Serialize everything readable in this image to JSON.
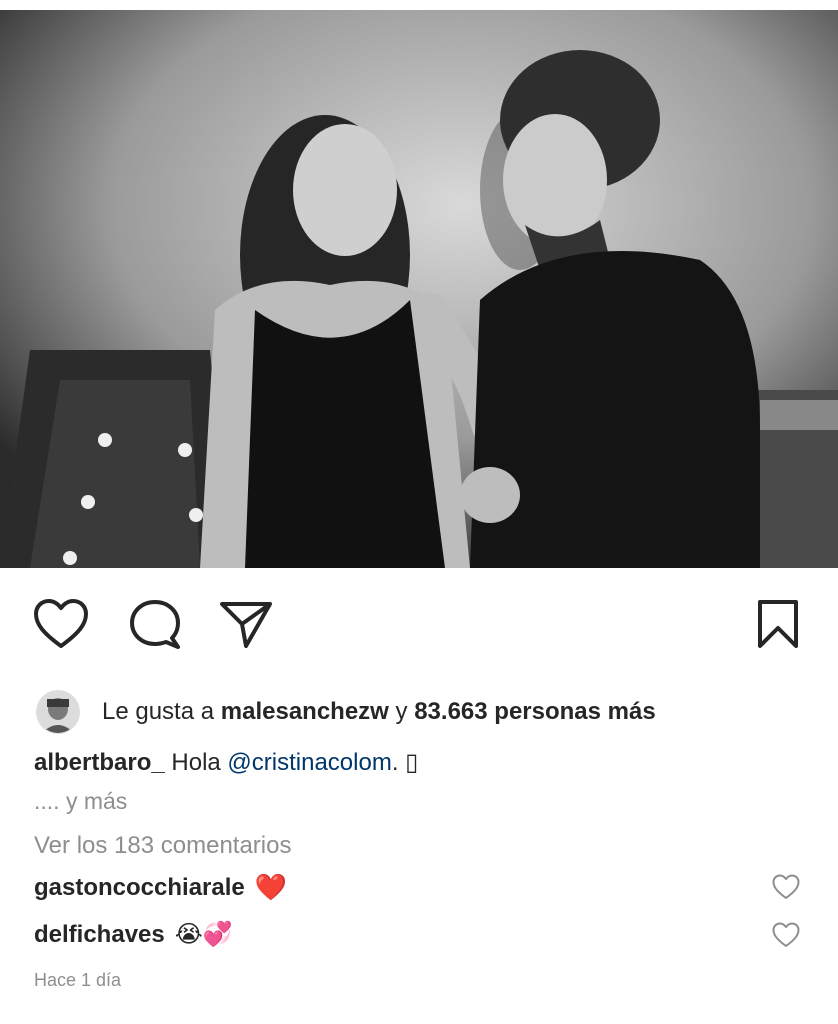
{
  "post": {
    "image_alt": "Black and white photo of a woman and a man smiling at each other"
  },
  "actions": {
    "like_icon": "heart-outline-icon",
    "comment_icon": "comment-bubble-icon",
    "share_icon": "paper-plane-icon",
    "save_icon": "bookmark-icon"
  },
  "likes": {
    "prefix": "Le gusta a ",
    "user": "malesanchezw",
    "middle": " y ",
    "count": "83.663 personas más"
  },
  "caption": {
    "user": "albertbaro_",
    "text": " Hola ",
    "mention": "@cristinacolom",
    "suffix": ". ▯",
    "more": ".... y más"
  },
  "view_comments": "Ver los 183 comentarios",
  "comments": [
    {
      "user": "gastoncocchiarale",
      "emoji": "❤️"
    },
    {
      "user": "delfichaves",
      "emoji": "😭💞"
    }
  ],
  "timestamp": "Hace 1 día"
}
